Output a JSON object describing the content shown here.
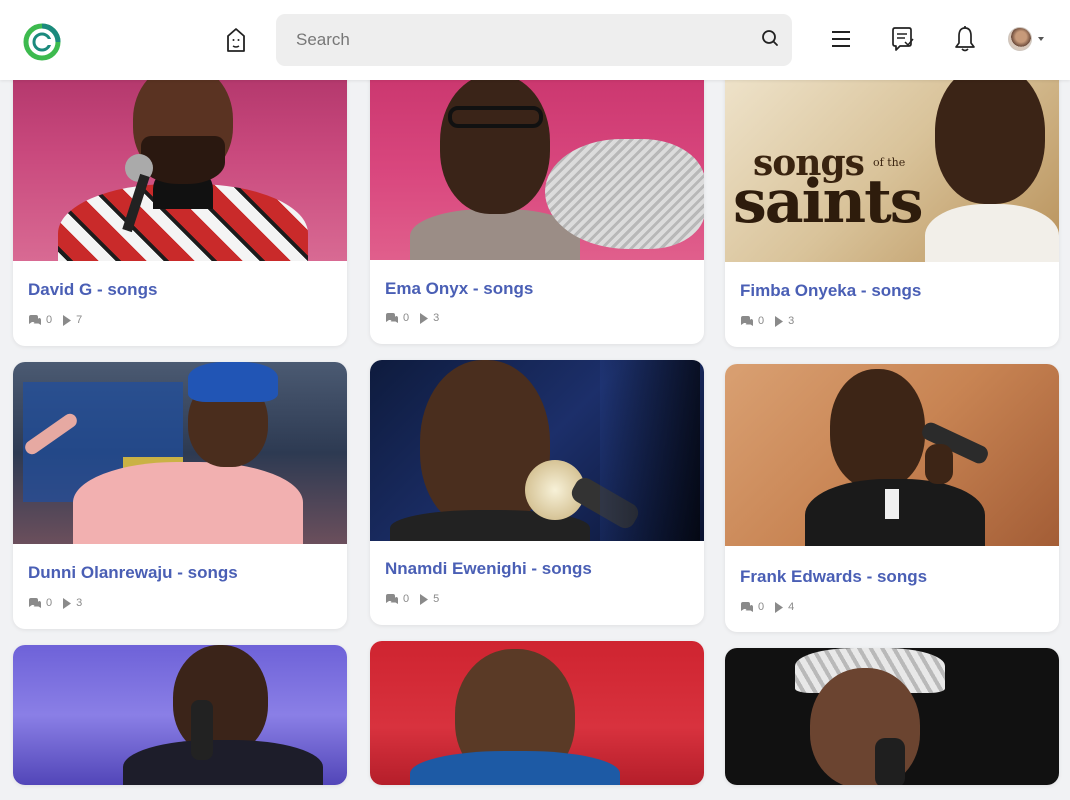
{
  "header": {
    "search_placeholder": "Search",
    "icons": [
      "app-logo",
      "home-icon",
      "search-icon",
      "menu-icon",
      "messages-icon",
      "bell-icon",
      "avatar"
    ]
  },
  "colors": {
    "accent": "#4a5fb5",
    "logo_green": "#3dba4e",
    "logo_teal": "#1b8a7d"
  },
  "cards": [
    {
      "title": "David G - songs",
      "comments": "0",
      "plays": "7"
    },
    {
      "title": "Ema Onyx - songs",
      "comments": "0",
      "plays": "3"
    },
    {
      "title": "Fimba Onyeka - songs",
      "comments": "0",
      "plays": "3"
    },
    {
      "title": "Dunni Olanrewaju - songs",
      "comments": "0",
      "plays": "3"
    },
    {
      "title": "Nnamdi Ewenighi - songs",
      "comments": "0",
      "plays": "5"
    },
    {
      "title": "Frank Edwards - songs",
      "comments": "0",
      "plays": "4"
    }
  ],
  "image_text": {
    "fimba_line1": "songs",
    "fimba_small": "of the",
    "fimba_line2": "saints"
  }
}
